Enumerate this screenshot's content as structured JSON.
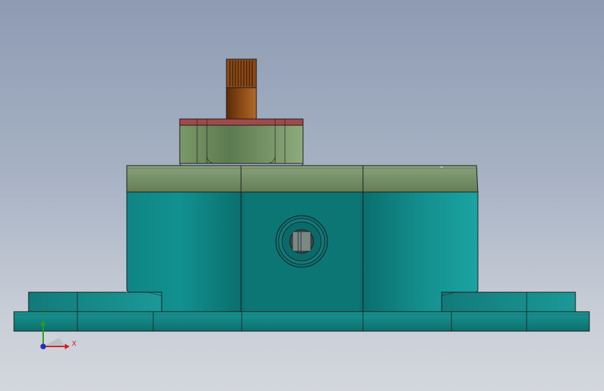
{
  "viewport": {
    "background_top": "#8e9bb3",
    "background_bottom": "#d3d7dd"
  },
  "model": {
    "colors": {
      "base": "#137d7c",
      "base_light": "#1a9a98",
      "housing": "#0f807f",
      "housing_highlight": "#1aa09e",
      "cover": "#6f8b62",
      "cover_light": "#809c72",
      "cap_ring": "#a04a4a",
      "shaft": "#7a3d10",
      "shaft_light": "#b06a2a",
      "outline": "#1a1a1a"
    }
  },
  "triad": {
    "x_label": "X",
    "y_label": "Y",
    "x_color": "#d02020",
    "y_color": "#20a020",
    "z_color": "#2030c0"
  }
}
